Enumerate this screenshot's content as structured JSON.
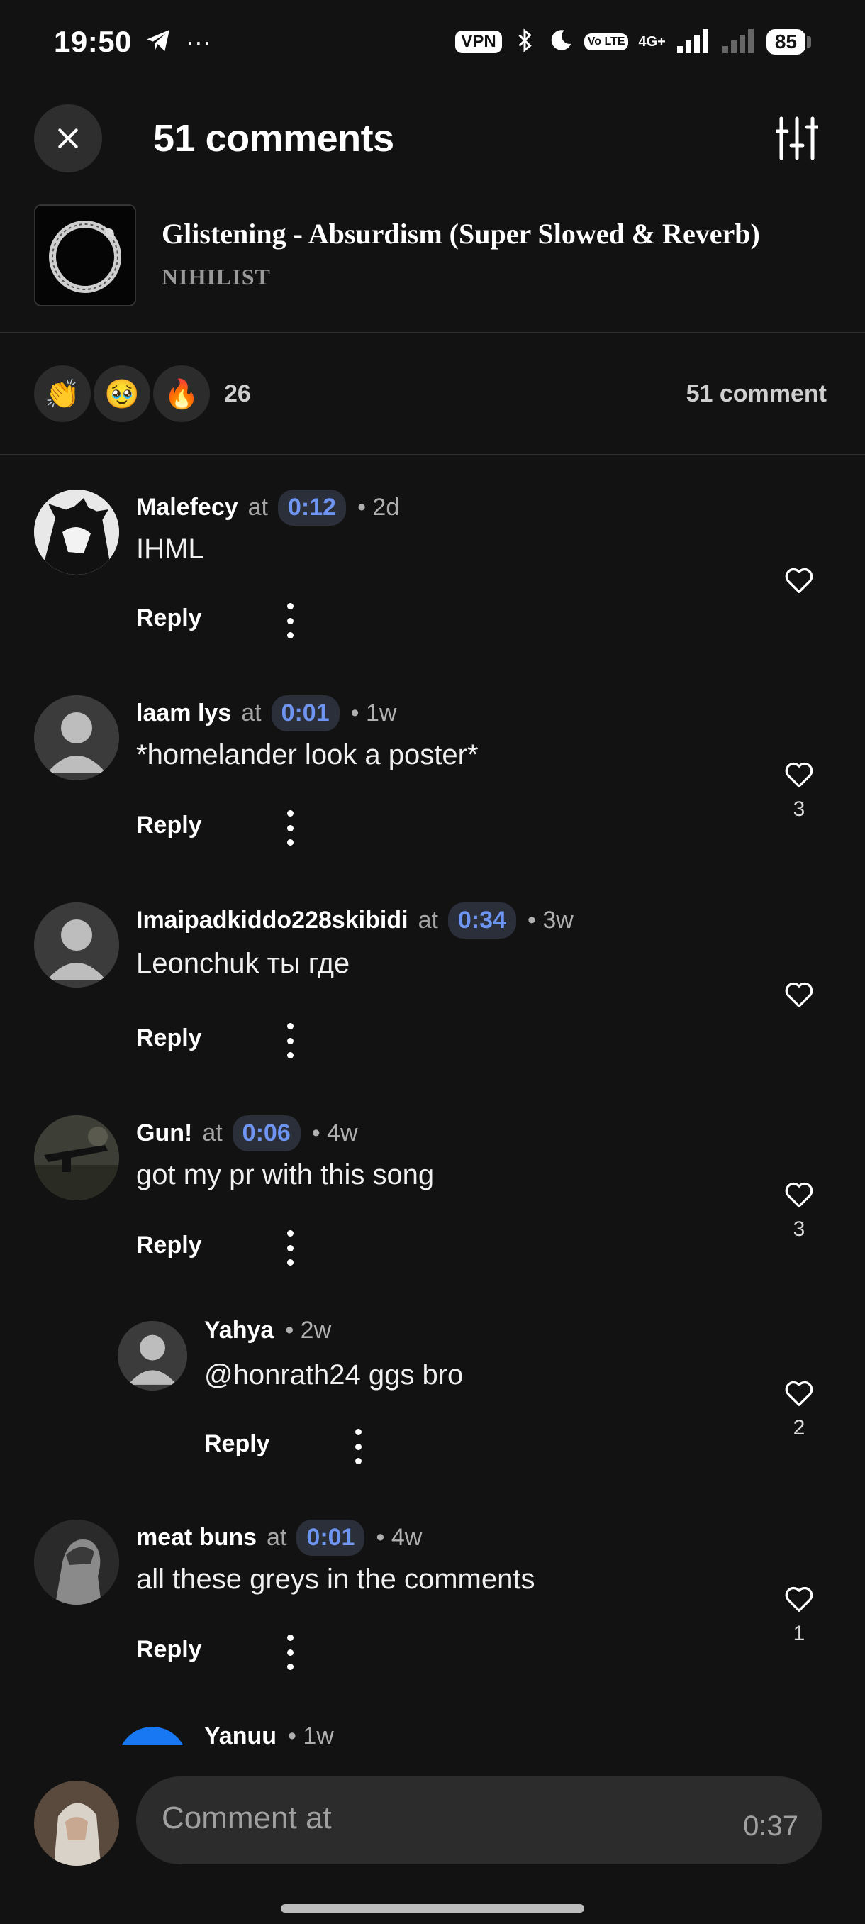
{
  "status_bar": {
    "time": "19:50",
    "vpn": "VPN",
    "volte": "Vo LTE",
    "network": "4G+",
    "battery": "85"
  },
  "header": {
    "title": "51 comments"
  },
  "track": {
    "title": "Glistening - Absurdism (Super Slowed & Reverb)",
    "artist": "NIHILIST"
  },
  "reactions": {
    "emojis": [
      "👏",
      "🥹",
      "🔥"
    ],
    "count": "26",
    "comments_label": "51 comment"
  },
  "comments": [
    {
      "user": "Malefecy",
      "at": "at",
      "timestamp": "0:12",
      "age": "• 2d",
      "text": "IHML",
      "reply": "Reply",
      "likes": ""
    },
    {
      "user": "laam lys",
      "at": "at",
      "timestamp": "0:01",
      "age": "• 1w",
      "text": "*homelander look a poster*",
      "reply": "Reply",
      "likes": "3"
    },
    {
      "user": "Imaipadkiddo228skibidi",
      "at": "at",
      "timestamp": "0:34",
      "age": "• 3w",
      "text": "Leonchuk ты где",
      "reply": "Reply",
      "likes": ""
    },
    {
      "user": "Gun!",
      "at": "at",
      "timestamp": "0:06",
      "age": "• 4w",
      "text": "got my pr with this song",
      "reply": "Reply",
      "likes": "3"
    },
    {
      "user": "Yahya",
      "age": "• 2w",
      "text": "@honrath24 ggs bro",
      "reply": "Reply",
      "likes": "2"
    },
    {
      "user": "meat buns",
      "at": "at",
      "timestamp": "0:01",
      "age": "• 4w",
      "text": "all these greys in the comments",
      "reply": "Reply",
      "likes": "1"
    },
    {
      "user": "Yanuu",
      "age": "• 1w"
    }
  ],
  "composer": {
    "placeholder": "Comment at",
    "time": "0:37"
  },
  "colors": {
    "background": "#121212",
    "timestamp_pill": "#2b2f3a",
    "timestamp_text": "#6e95f2"
  }
}
